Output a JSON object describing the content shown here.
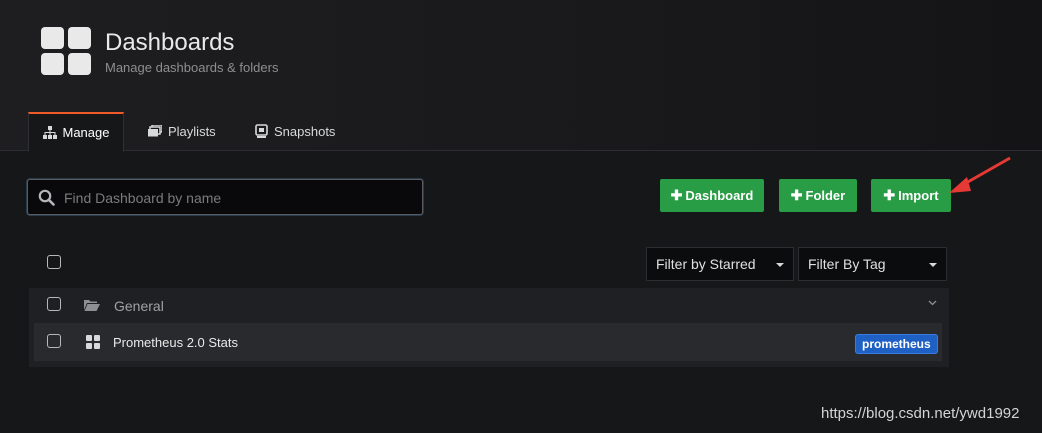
{
  "header": {
    "title": "Dashboards",
    "subtitle": "Manage dashboards & folders",
    "logo_icon": "dashboards-grid-icon"
  },
  "tabs": [
    {
      "label": "Manage",
      "icon": "sitemap-icon",
      "active": true
    },
    {
      "label": "Playlists",
      "icon": "playlist-icon",
      "active": false
    },
    {
      "label": "Snapshots",
      "icon": "snapshot-icon",
      "active": false
    }
  ],
  "search": {
    "placeholder": "Find Dashboard by name",
    "value": ""
  },
  "actions": {
    "dashboard_label": "Dashboard",
    "folder_label": "Folder",
    "import_label": "Import",
    "color": "#299c46"
  },
  "filters": {
    "starred_label": "Filter by Starred",
    "tag_label": "Filter By Tag"
  },
  "folders": [
    {
      "name": "General",
      "dashboards": [
        {
          "title": "Prometheus 2.0 Stats",
          "tags": [
            "prometheus"
          ]
        }
      ]
    }
  ],
  "watermark": "https://blog.csdn.net/ywd1992",
  "colors": {
    "accent": "#f05a28",
    "tag": "#1f60c4",
    "annotation_arrow": "#e53935"
  }
}
